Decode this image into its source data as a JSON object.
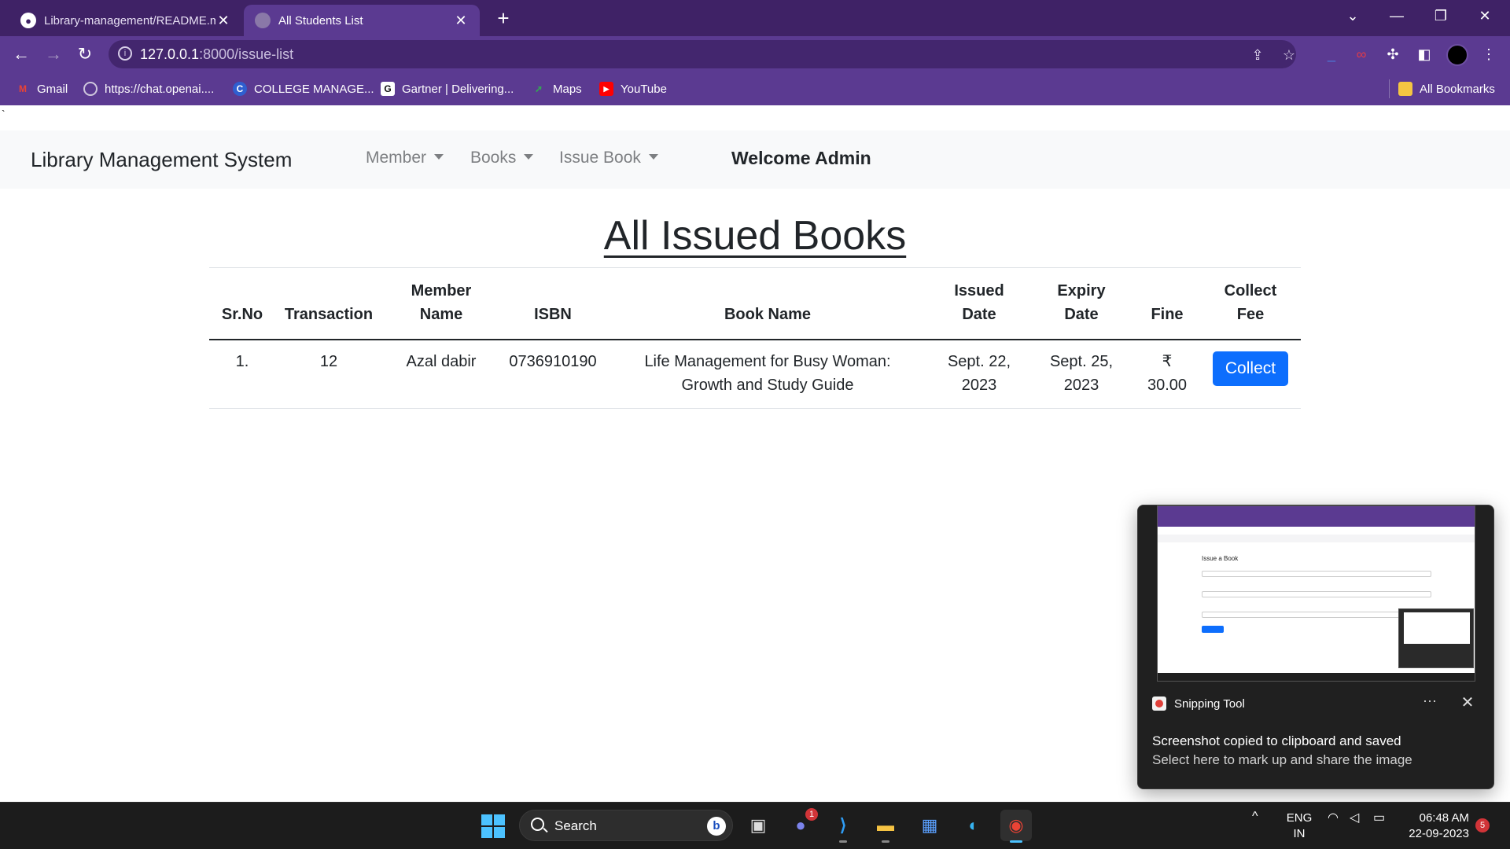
{
  "browser": {
    "tabs": [
      {
        "title": "Library-management/README.m",
        "icon": "github-icon",
        "active": false
      },
      {
        "title": "All Students List",
        "icon": "globe-icon",
        "active": true
      }
    ],
    "url": {
      "host": "127.0.0.1",
      "path": ":8000/issue-list"
    },
    "bookmarks": [
      {
        "label": "Gmail",
        "icon": "gmail-icon"
      },
      {
        "label": "https://chat.openai....",
        "icon": "openai-icon"
      },
      {
        "label": "COLLEGE MANAGE...",
        "icon": "college-icon"
      },
      {
        "label": "Gartner | Delivering...",
        "icon": "gartner-icon"
      },
      {
        "label": "Maps",
        "icon": "maps-icon"
      },
      {
        "label": "YouTube",
        "icon": "youtube-icon"
      }
    ],
    "all_bookmarks_label": "All Bookmarks"
  },
  "page": {
    "stray_char": "`",
    "navbar": {
      "brand": "Library Management System",
      "links": [
        "Member",
        "Books",
        "Issue Book"
      ],
      "welcome": "Welcome Admin"
    },
    "heading": "All Issued Books",
    "table": {
      "headers": [
        [
          "Sr.No"
        ],
        [
          "Transaction"
        ],
        [
          "Member",
          "Name"
        ],
        [
          "ISBN"
        ],
        [
          "Book Name"
        ],
        [
          "Issued",
          "Date"
        ],
        [
          "Expiry",
          "Date"
        ],
        [
          "Fine"
        ],
        [
          "Collect",
          "Fee"
        ]
      ],
      "rows": [
        {
          "sr_no": "1.",
          "transaction": "12",
          "member_name": "Azal dabir",
          "isbn": "0736910190",
          "book_name": [
            "Life Management for Busy Woman:",
            "Growth and Study Guide"
          ],
          "issued_date": [
            "Sept. 22,",
            "2023"
          ],
          "expiry_date": [
            "Sept. 25,",
            "2023"
          ],
          "fine": [
            "₹",
            "30.00"
          ],
          "action": "Collect"
        }
      ]
    }
  },
  "toast": {
    "app_name": "Snipping Tool",
    "more": "···",
    "title": "Screenshot copied to clipboard and saved",
    "subtitle": "Select here to mark up and share the image",
    "thumb_title": "Issue a Book"
  },
  "taskbar": {
    "search_label": "Search",
    "teams_badge": "1",
    "lang": [
      "ENG",
      "IN"
    ],
    "time": "06:48 AM",
    "date": "22-09-2023",
    "notifications": "5"
  },
  "colors": {
    "chrome_dark": "#3f2266",
    "chrome": "#5b3a91",
    "primary_button": "#0d6efd",
    "navbar_bg": "#f8f9fa"
  }
}
